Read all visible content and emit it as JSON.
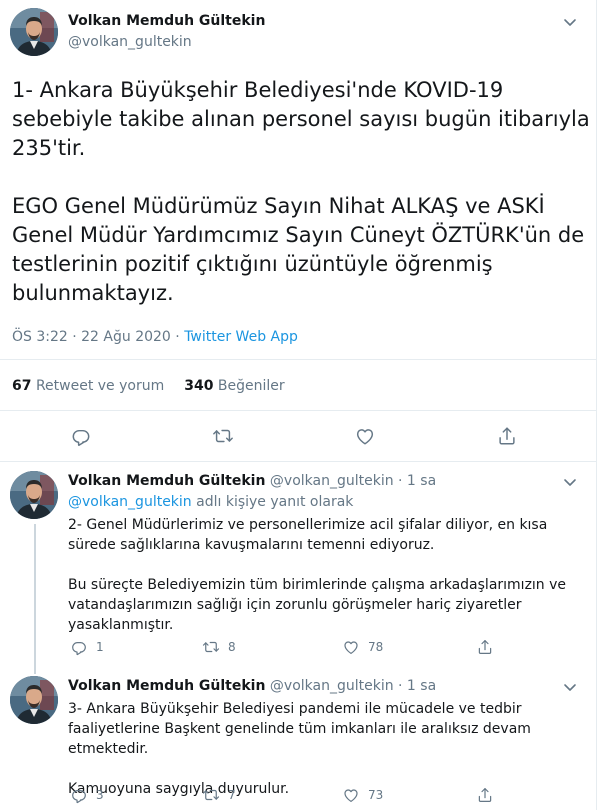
{
  "main_tweet": {
    "author_name": "Volkan Memduh Gültekin",
    "handle": "@volkan_gultekin",
    "text": "1- Ankara Büyükşehir Belediyesi'nde KOVID-19 sebebiyle takibe alınan personel sayısı bugün itibarıyla 235'tir.\n\nEGO Genel Müdürümüz Sayın Nihat ALKAŞ ve ASKİ Genel Müdür Yardımcımız Sayın Cüneyt ÖZTÜRK'ün de testlerinin pozitif çıktığını üzüntüyle öğrenmiş bulunmaktayız.",
    "timestamp": "ÖS 3:22 · 22 Ağu 2020 · ",
    "source_app": "Twitter Web App",
    "retweet_count": "67",
    "retweet_label": "Retweet ve yorum",
    "like_count": "340",
    "like_label": "Beğeniler",
    "icons": [
      "reply-icon",
      "retweet-icon",
      "like-icon",
      "share-icon",
      "chevron-down-icon"
    ]
  },
  "replies": [
    {
      "author_name": "Volkan Memduh Gültekin",
      "handle": "@volkan_gultekin · 1 sa",
      "reply_to_handle": "@volkan_gultekin",
      "reply_to_suffix": " adlı kişiye yanıt olarak",
      "text": "2- Genel Müdürlerimiz ve personellerimize acil şifalar diliyor, en kısa sürede sağlıklarına kavuşmalarını temenni ediyoruz.\n\nBu süreçte Belediyemizin tüm birimlerinde çalışma arkadaşlarımızın ve vatandaşlarımızın sağlığı için zorunlu görüşmeler hariç ziyaretler yasaklanmıştır.",
      "reply_count": "1",
      "retweet_count": "8",
      "like_count": "78"
    },
    {
      "author_name": "Volkan Memduh Gültekin",
      "handle": "@volkan_gultekin · 1 sa",
      "text": "3- Ankara Büyükşehir Belediyesi pandemi ile mücadele ve tedbir faaliyetlerine Başkent genelinde tüm imkanları ile aralıksız devam etmektedir.\n\nKamuoyuna saygıyla duyurulur.",
      "reply_count": "3",
      "retweet_count": "7",
      "like_count": "73"
    }
  ],
  "colors": {
    "text": "#14171a",
    "secondary": "#657786",
    "link": "#1b95e0",
    "divider": "#e6ecf0"
  }
}
